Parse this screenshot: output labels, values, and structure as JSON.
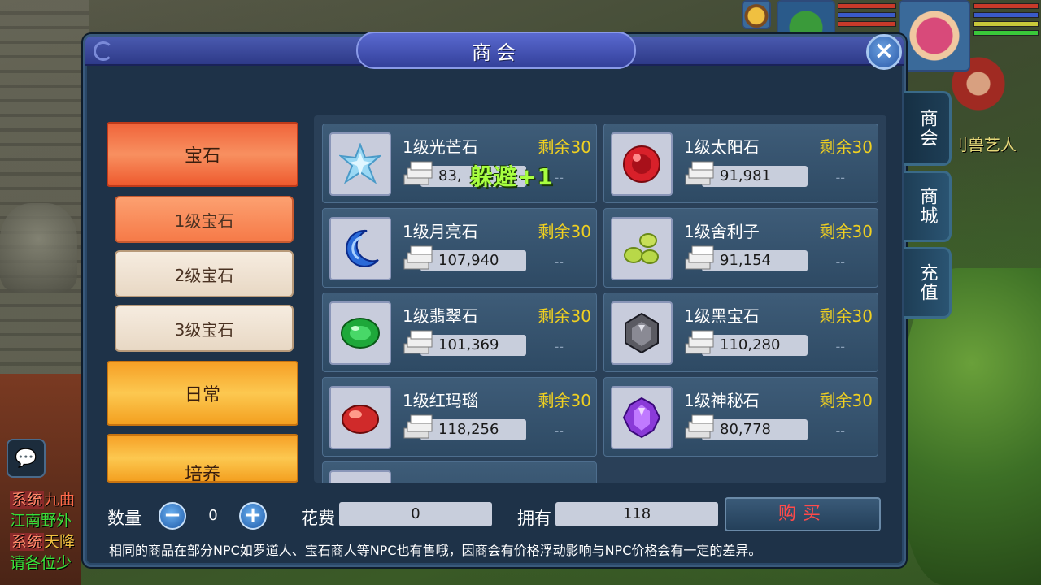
{
  "window": {
    "title": "商会",
    "close_icon": "×"
  },
  "categories": [
    {
      "label": "宝石",
      "color": "red"
    },
    {
      "label": "日常",
      "color": "orange"
    },
    {
      "label": "培养",
      "color": "orange"
    }
  ],
  "subcategories": [
    {
      "label": "1级宝石",
      "active": true
    },
    {
      "label": "2级宝石",
      "active": false
    },
    {
      "label": "3级宝石",
      "active": false
    }
  ],
  "items": [
    {
      "name": "1级光芒石",
      "stock": "剩余30",
      "price": "83,",
      "dash": "--",
      "gem": "crystal-icon"
    },
    {
      "name": "1级太阳石",
      "stock": "剩余30",
      "price": "91,981",
      "dash": "--",
      "gem": "ruby-icon"
    },
    {
      "name": "1级月亮石",
      "stock": "剩余30",
      "price": "107,940",
      "dash": "--",
      "gem": "moonstone-icon"
    },
    {
      "name": "1级舍利子",
      "stock": "剩余30",
      "price": "91,154",
      "dash": "--",
      "gem": "sarira-icon"
    },
    {
      "name": "1级翡翠石",
      "stock": "剩余30",
      "price": "101,369",
      "dash": "--",
      "gem": "emerald-icon"
    },
    {
      "name": "1级黑宝石",
      "stock": "剩余30",
      "price": "110,280",
      "dash": "--",
      "gem": "black-gem-icon"
    },
    {
      "name": "1级红玛瑙",
      "stock": "剩余30",
      "price": "118,256",
      "dash": "--",
      "gem": "agate-icon"
    },
    {
      "name": "1级神秘石",
      "stock": "剩余30",
      "price": "80,778",
      "dash": "--",
      "gem": "mystery-stone-icon"
    }
  ],
  "floating_text": "躲避+1",
  "side_tabs": [
    {
      "label": "商会",
      "active": true
    },
    {
      "label": "商城",
      "active": false
    },
    {
      "label": "充值",
      "active": false
    }
  ],
  "footer": {
    "quantity_label": "数量",
    "quantity_value": "0",
    "minus": "−",
    "plus": "+",
    "cost_label": "花费",
    "cost_value": "0",
    "owned_label": "拥有",
    "owned_value": "118",
    "buy_label": "购买",
    "notice": "相同的商品在部分NPC如罗道人、宝石商人等NPC也有售哦，因商会有价格浮动影响与NPC价格会有一定的差异。"
  },
  "world": {
    "npc_label": "刂兽艺人",
    "chat_icon": "speech-bubble-icon",
    "chat_lines": [
      {
        "tag": "系统",
        "text": "九曲"
      },
      {
        "tag": "",
        "text": "江南野外"
      },
      {
        "tag": "系统",
        "text": "天降"
      },
      {
        "tag": "",
        "text": "请各位少"
      }
    ]
  },
  "colors": {
    "stock": "#f0d020",
    "buy": "#ff4a4a",
    "panel": "#1e3248",
    "floating": "#a8ff40"
  }
}
